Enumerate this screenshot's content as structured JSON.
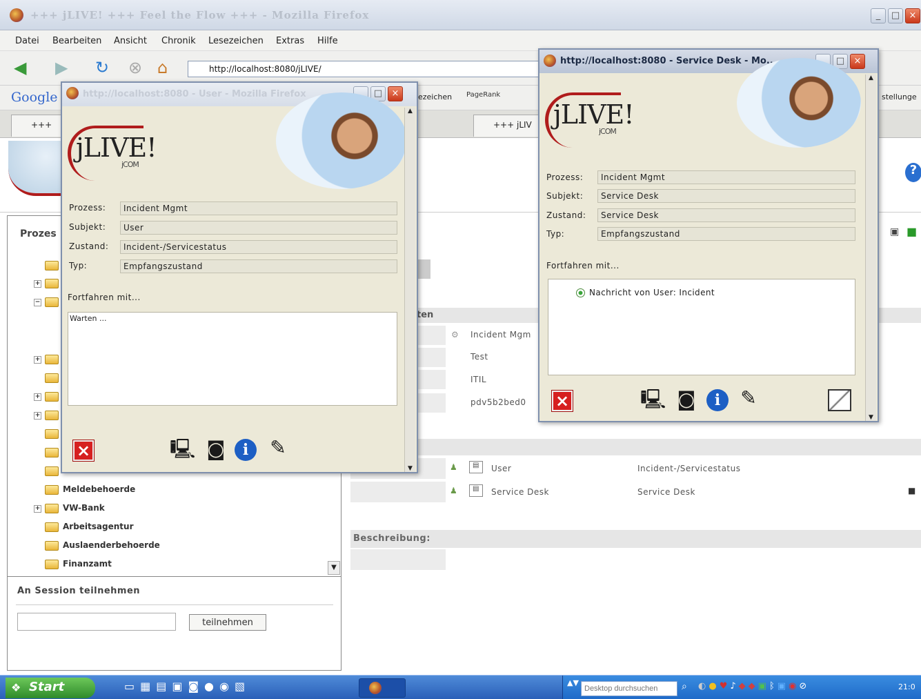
{
  "main_window": {
    "title": "+++ jLIVE! +++ Feel the Flow +++ - Mozilla Firefox"
  },
  "menu": [
    "Datei",
    "Bearbeiten",
    "Ansicht",
    "Chronik",
    "Lesezeichen",
    "Extras",
    "Hilfe"
  ],
  "address_bar": {
    "url": "http://localhost:8080/jLIVE/"
  },
  "google_bar": {
    "logo": "Google",
    "bookmarks_fragment": "ezeichen",
    "pagerank": "PageRank",
    "settings_fragment": "stellunge"
  },
  "tabs": [
    "+++",
    "+++ jLIV"
  ],
  "left_panel": {
    "heading": "Prozes",
    "tree_items": [
      "Meldebehoerde",
      "VW-Bank",
      "Arbeitsagentur",
      "Auslaenderbehoerde",
      "Finanzamt"
    ],
    "session_heading": "An Session teilnehmen",
    "session_input_value": "",
    "join_button": "teilnehmen"
  },
  "right_area": {
    "section_fragment": "ten",
    "list_rows": [
      "Incident Mgm",
      "Test",
      "ITIL",
      "pdv5b2bed0"
    ],
    "participants": [
      {
        "name": "User",
        "state": "Incident-/Servicestatus"
      },
      {
        "name": "Service Desk",
        "state": "Service Desk"
      }
    ],
    "beschreibung_label": "Beschreibung:"
  },
  "popup_user": {
    "title": "http://localhost:8080 - User - Mozilla Firefox",
    "logo": "jLIVE!",
    "logo_sub": "jCOM",
    "labels": {
      "prozess": "Prozess:",
      "subjekt": "Subjekt:",
      "zustand": "Zustand:",
      "typ": "Typ:"
    },
    "values": {
      "prozess": "Incident Mgmt",
      "subjekt": "User",
      "zustand": "Incident-/Servicestatus",
      "typ": "Empfangszustand"
    },
    "continue_label": "Fortfahren mit...",
    "status_text": "Warten ..."
  },
  "popup_service": {
    "title": "http://localhost:8080 - Service Desk - Mo...",
    "logo": "jLIVE!",
    "logo_sub": "jCOM",
    "labels": {
      "prozess": "Prozess:",
      "subjekt": "Subjekt:",
      "zustand": "Zustand:",
      "typ": "Typ:"
    },
    "values": {
      "prozess": "Incident Mgmt",
      "subjekt": "Service Desk",
      "zustand": "Service Desk",
      "typ": "Empfangszustand"
    },
    "continue_label": "Fortfahren mit...",
    "option": "Nachricht von User: Incident"
  },
  "taskbar": {
    "start": "Start",
    "search_placeholder": "Desktop durchsuchen",
    "clock": "21:0"
  },
  "colors": {
    "accent_red": "#d62020",
    "xp_blue": "#2a5fb8",
    "xp_green": "#2f8a2a",
    "dialog_bg": "#ece9d8"
  }
}
